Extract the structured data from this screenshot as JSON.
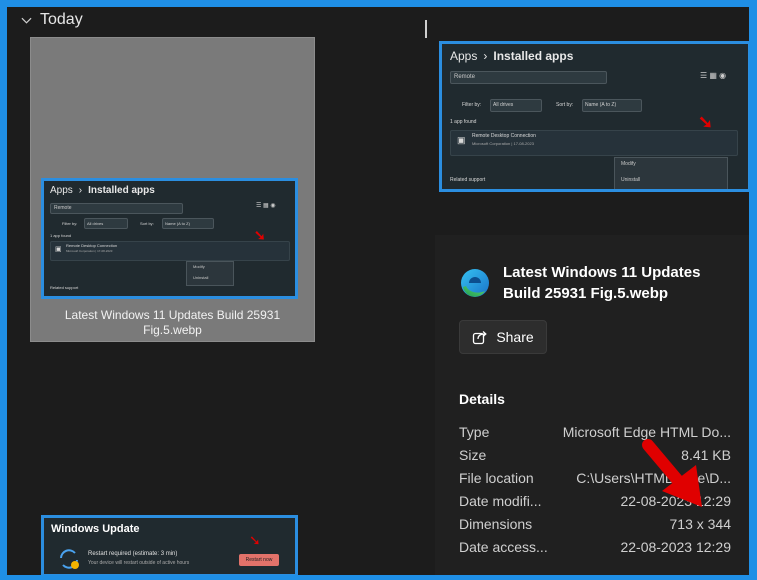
{
  "group": {
    "label": "Today"
  },
  "tile": {
    "caption": "Latest Windows 11 Updates Build 25931 Fig.5.webp"
  },
  "mini_left": {
    "crumb_root": "Apps",
    "crumb_sep": "›",
    "crumb_page": "Installed apps",
    "search_value": "Remote",
    "filter_label": "Filter by:",
    "filter_value": "All drives",
    "sort_label": "Sort by:",
    "sort_value": "Name (A to Z)",
    "count": "1 app found",
    "app_name": "Remote Desktop Connection",
    "app_meta": "Microsoft Corporation | 17-08-2023",
    "menu_modify": "Modify",
    "menu_uninstall": "Uninstall",
    "related": "Related support"
  },
  "mini_right": {
    "crumb_root": "Apps",
    "crumb_sep": "›",
    "crumb_page": "Installed apps",
    "search_value": "Remote",
    "filter_label": "Filter by:",
    "filter_value": "All drives",
    "sort_label": "Sort by:",
    "sort_value": "Name (A to Z)",
    "count": "1 app found",
    "app_name": "Remote Desktop Connection",
    "app_meta": "Microsoft Corporation | 17-08-2023",
    "menu_modify": "Modify",
    "menu_uninstall": "Uninstall",
    "related": "Related support"
  },
  "windows_update": {
    "title": "Windows Update",
    "status": "Restart required (estimate: 3 min)",
    "substatus": "Your device will restart outside of active hours",
    "restart_label": "Restart now"
  },
  "file": {
    "name": "Latest Windows 11 Updates Build 25931 Fig.5.webp",
    "share_label": "Share"
  },
  "details": {
    "title": "Details",
    "rows": [
      {
        "key": "Type",
        "value": "Microsoft Edge HTML Do..."
      },
      {
        "key": "Size",
        "value": "8.41 KB"
      },
      {
        "key": "File location",
        "value": "C:\\Users\\HTMD\\...ce\\D..."
      },
      {
        "key": "Date modifi...",
        "value": "22-08-2023 12:29"
      },
      {
        "key": "Dimensions",
        "value": "713 x 344"
      },
      {
        "key": "Date access...",
        "value": "22-08-2023 12:29"
      }
    ]
  },
  "colors": {
    "accent": "#2b8ee0",
    "arrow": "#e00000",
    "background": "#1c1c1c"
  }
}
